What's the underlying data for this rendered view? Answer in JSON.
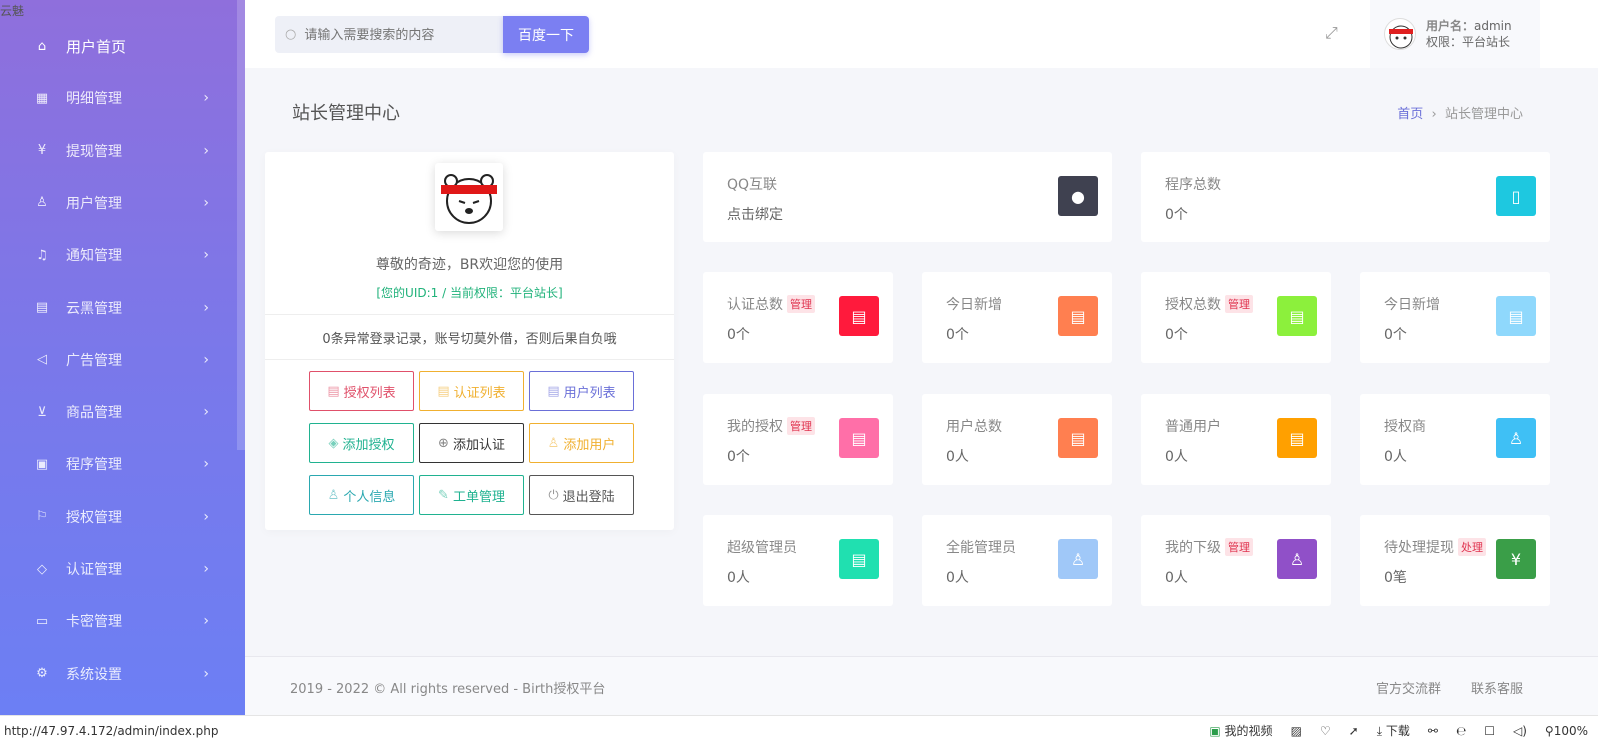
{
  "watermark": "云魅",
  "sidebar": {
    "items": [
      {
        "label": "用户首页",
        "icon": "home-icon",
        "glyph": "⌂"
      },
      {
        "label": "明细管理",
        "icon": "table-icon",
        "glyph": "▦"
      },
      {
        "label": "提现管理",
        "icon": "yen-icon",
        "glyph": "¥"
      },
      {
        "label": "用户管理",
        "icon": "user-icon",
        "glyph": "♙"
      },
      {
        "label": "通知管理",
        "icon": "bell-icon",
        "glyph": "♫"
      },
      {
        "label": "云黑管理",
        "icon": "clipboard-icon",
        "glyph": "▤"
      },
      {
        "label": "广告管理",
        "icon": "speaker-icon",
        "glyph": "◁"
      },
      {
        "label": "商品管理",
        "icon": "cart-icon",
        "glyph": "⊻"
      },
      {
        "label": "程序管理",
        "icon": "apps-icon",
        "glyph": "▣"
      },
      {
        "label": "授权管理",
        "icon": "flag-icon",
        "glyph": "⚐"
      },
      {
        "label": "认证管理",
        "icon": "shield-icon",
        "glyph": "◇"
      },
      {
        "label": "卡密管理",
        "icon": "card-icon",
        "glyph": "▭"
      },
      {
        "label": "系统设置",
        "icon": "gear-icon",
        "glyph": "⚙"
      }
    ]
  },
  "header": {
    "search_placeholder": "请输入需要搜索的内容",
    "search_button": "百度一下",
    "user_name_label": "用户名：",
    "user_name": "admin",
    "role_label": "权限：",
    "role": "平台站长"
  },
  "page": {
    "title": "站长管理中心",
    "breadcrumb": [
      "首页",
      "站长管理中心"
    ]
  },
  "profile": {
    "welcome": "尊敬的奇迹，BR欢迎您的使用",
    "uid_line": "[您的UID:1 / 当前权限：平台站长]",
    "warning": "0条异常登录记录，账号切莫外借，否则后果自负哦",
    "buttons": [
      {
        "label": "授权列表",
        "color": "#e0506a",
        "glyph": "▤"
      },
      {
        "label": "认证列表",
        "color": "#f0b030",
        "glyph": "▤"
      },
      {
        "label": "用户列表",
        "color": "#6a6fd8",
        "glyph": "▤"
      },
      {
        "label": "添加授权",
        "color": "#20b290",
        "glyph": "◈"
      },
      {
        "label": "添加认证",
        "color": "#333333",
        "glyph": "⊕"
      },
      {
        "label": "添加用户",
        "color": "#f0b030",
        "glyph": "♙"
      },
      {
        "label": "个人信息",
        "color": "#2aa8b0",
        "glyph": "♙"
      },
      {
        "label": "工单管理",
        "color": "#20b290",
        "glyph": "✎"
      },
      {
        "label": "退出登陆",
        "color": "#555555",
        "glyph": "⏻"
      }
    ]
  },
  "cards": [
    {
      "label": "QQ互联",
      "value": "点击绑定",
      "color": "#3f4150",
      "glyph": "●"
    },
    {
      "label": "程序总数",
      "value": "0个",
      "color": "#1ec8e0",
      "glyph": "▯"
    },
    {
      "label": "认证总数",
      "tag": "管理",
      "value": "0个",
      "color": "#ff1a3c",
      "glyph": "▤"
    },
    {
      "label": "今日新增",
      "value": "0个",
      "color": "#ff7f50",
      "glyph": "▤"
    },
    {
      "label": "授权总数",
      "tag": "管理",
      "value": "0个",
      "color": "#8cf03c",
      "glyph": "▤"
    },
    {
      "label": "今日新增",
      "value": "0个",
      "color": "#8fd8fc",
      "glyph": "▤"
    },
    {
      "label": "我的授权",
      "tag": "管理",
      "value": "0个",
      "color": "#ff6fa8",
      "glyph": "▤"
    },
    {
      "label": "用户总数",
      "value": "0人",
      "color": "#ff7f50",
      "glyph": "▤"
    },
    {
      "label": "普通用户",
      "value": "0人",
      "color": "#ffa000",
      "glyph": "▤"
    },
    {
      "label": "授权商",
      "value": "0人",
      "color": "#3fc0f5",
      "glyph": "♙"
    },
    {
      "label": "超级管理员",
      "value": "0人",
      "color": "#20e0b0",
      "glyph": "▤"
    },
    {
      "label": "全能管理员",
      "value": "0人",
      "color": "#a0c8f8",
      "glyph": "♙"
    },
    {
      "label": "我的下级",
      "tag": "管理",
      "value": "0人",
      "color": "#9050c8",
      "glyph": "♙"
    },
    {
      "label": "待处理提现",
      "tag": "处理",
      "value": "0笔",
      "color": "#3a9e48",
      "glyph": "¥"
    }
  ],
  "footer": {
    "copyright": "2019 - 2022 © All rights reserved - Birth授权平台",
    "links": [
      "官方交流群",
      "联系客服"
    ]
  },
  "statusbar": {
    "url": "http://47.97.4.172/admin/index.php",
    "video": "我的视频",
    "download": "下载",
    "zoom": "100%"
  }
}
